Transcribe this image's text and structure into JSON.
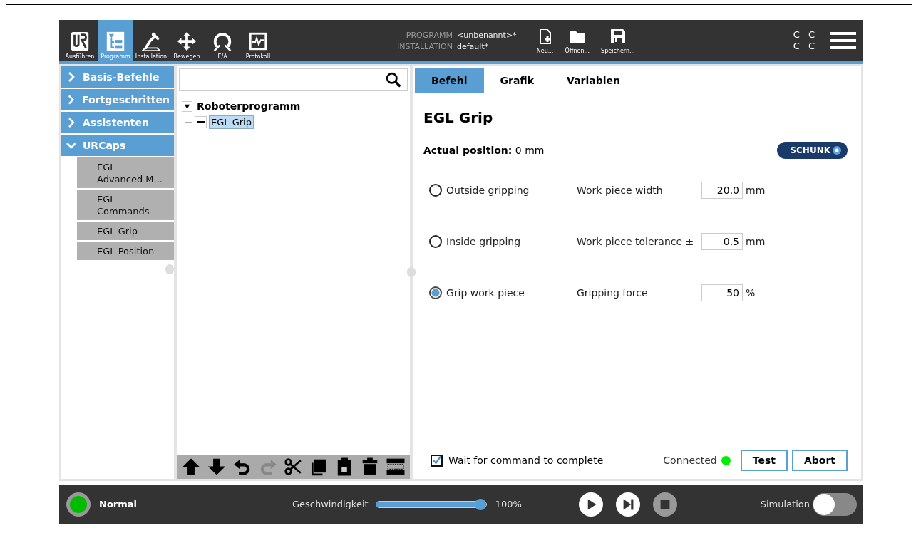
{
  "header": {
    "nav_tabs": [
      {
        "label": "Ausführen",
        "selected": false
      },
      {
        "label": "Programm",
        "selected": true
      },
      {
        "label": "Installation",
        "selected": false
      },
      {
        "label": "Bewegen",
        "selected": false
      },
      {
        "label": "E/A",
        "selected": false
      },
      {
        "label": "Protokoll",
        "selected": false
      }
    ],
    "program_info": [
      {
        "label": "PROGRAMM",
        "value": "<unbenannt>*"
      },
      {
        "label": "INSTALLATION",
        "value": "default*"
      }
    ],
    "file_buttons": [
      "Neu...",
      "Öffnen...",
      "Speichern..."
    ],
    "status_letters": [
      "C",
      "C",
      "C",
      "C"
    ]
  },
  "sidebar": {
    "categories": [
      {
        "label": "Basis-Befehle",
        "expanded": false
      },
      {
        "label": "Fortgeschritten",
        "expanded": false
      },
      {
        "label": "Assistenten",
        "expanded": false
      },
      {
        "label": "URCaps",
        "expanded": true
      }
    ],
    "items": [
      "EGL\nAdvanced M...",
      "EGL\nCommands",
      "EGL Grip",
      "EGL Position"
    ]
  },
  "tree": {
    "root": {
      "label": "Roboterprogramm",
      "expanded": true,
      "children": [
        {
          "label": "EGL Grip",
          "selected": true
        }
      ]
    },
    "tools": [
      {
        "disabled": false
      },
      {
        "disabled": false
      },
      {
        "disabled": false
      },
      {
        "disabled": true
      },
      {
        "disabled": false
      },
      {
        "disabled": false
      },
      {
        "disabled": false
      },
      {
        "disabled": false
      },
      {
        "disabled": false
      }
    ]
  },
  "tabs": [
    {
      "label": "Befehl",
      "selected": true
    },
    {
      "label": "Grafik",
      "selected": false
    },
    {
      "label": "Variablen",
      "selected": false
    }
  ],
  "command": {
    "title": "EGL Grip",
    "position_label": "Actual position:",
    "position_value": "0 mm",
    "logo": "SCHUNK",
    "options": [
      {
        "label": "Outside gripping",
        "selected": false,
        "field_label": "Work piece width",
        "value": "20.0",
        "unit": "mm"
      },
      {
        "label": "Inside gripping",
        "selected": false,
        "field_label": "Work piece tolerance ±",
        "value": "0.5",
        "unit": "mm"
      },
      {
        "label": "Grip work piece",
        "selected": true,
        "field_label": "Gripping force",
        "value": "50",
        "unit": "%"
      }
    ],
    "wait": {
      "label": "Wait for command to complete",
      "checked": true
    },
    "connection": {
      "label": "Connected",
      "color": "#00ee00"
    },
    "buttons": [
      "Test",
      "Abort"
    ]
  },
  "footer": {
    "status": {
      "label": "Normal",
      "color": "#00bb00"
    },
    "speed_label": "Geschwindigkeit",
    "speed": {
      "level": 1.0
    },
    "speed_reading": "100%",
    "controls": [
      {
        "disabled": false
      },
      {
        "disabled": false
      },
      {
        "disabled": true
      }
    ],
    "simulation": {
      "label": "Simulation",
      "on": false
    }
  }
}
